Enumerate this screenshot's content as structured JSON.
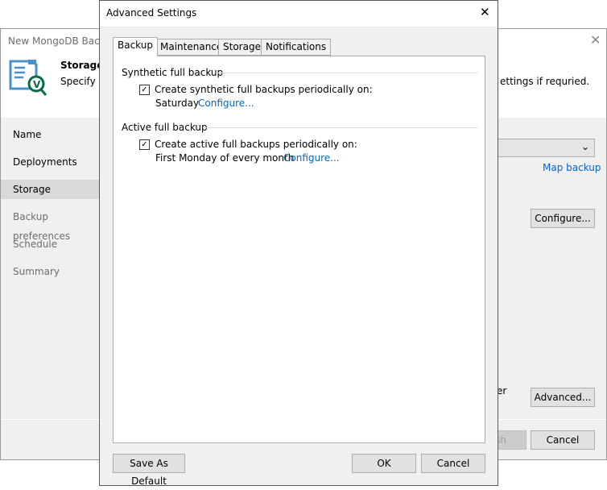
{
  "background_window": {
    "title": "New MongoDB Backu",
    "header_title": "Storage",
    "header_subtitle": "Specify ba",
    "header_subtitle_tail": "ettings if requried.",
    "nav": [
      {
        "label": "Name",
        "state": "normal"
      },
      {
        "label": "Deployments",
        "state": "normal"
      },
      {
        "label": "Storage",
        "state": "selected"
      },
      {
        "label": "Backup preferences",
        "state": "disabled"
      },
      {
        "label": "Schedule",
        "state": "disabled"
      },
      {
        "label": "Summary",
        "state": "disabled"
      }
    ],
    "map_backup_link": "Map backup",
    "configure_button": "Configure...",
    "partial_text": "er",
    "advanced_button": "Advanced...",
    "finish_button": "sh",
    "cancel_button": "Cancel"
  },
  "dialog": {
    "title": "Advanced Settings",
    "tabs": [
      "Backup",
      "Maintenance",
      "Storage",
      "Notifications"
    ],
    "active_tab": "Backup",
    "synthetic": {
      "heading": "Synthetic full backup",
      "checkbox_label": "Create synthetic full backups periodically on:",
      "checked": true,
      "schedule": "Saturday",
      "configure_link": "Configure..."
    },
    "active": {
      "heading": "Active full backup",
      "checkbox_label": "Create active full backups periodically on:",
      "checked": true,
      "schedule": "First Monday of every month",
      "configure_link": "Configure..."
    },
    "save_default_button": "Save As Default",
    "ok_button": "OK",
    "cancel_button": "Cancel"
  }
}
